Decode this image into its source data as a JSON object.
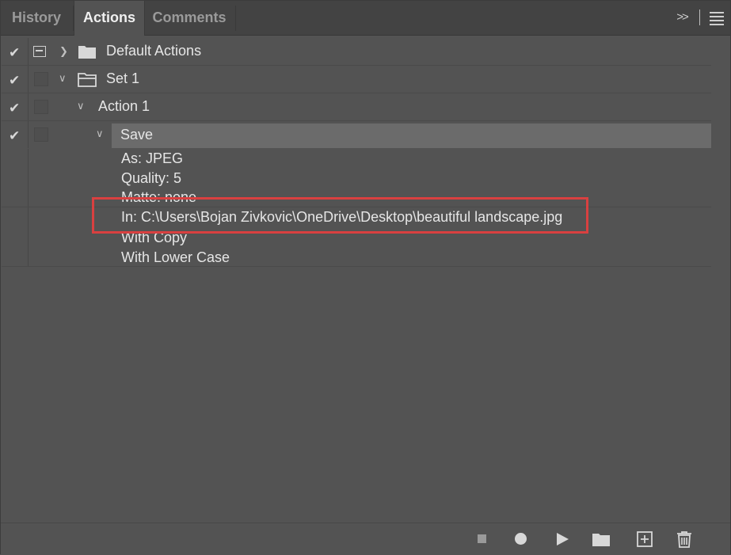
{
  "tabs": [
    {
      "label": "History",
      "active": false
    },
    {
      "label": "Actions",
      "active": true
    },
    {
      "label": "Comments",
      "active": false
    }
  ],
  "header": {
    "collapse_icon": "double-chevron-right-icon",
    "menu_icon": "panel-menu-icon"
  },
  "rows": {
    "default_actions": {
      "label": "Default Actions",
      "checked": true,
      "expanded": false
    },
    "set1": {
      "label": "Set 1",
      "checked": true,
      "expanded": true
    },
    "action1": {
      "label": "Action 1",
      "checked": true,
      "expanded": true
    },
    "save": {
      "label": "Save",
      "checked": true,
      "expanded": true,
      "selected": true
    }
  },
  "save_params": [
    "As: JPEG",
    "Quality: 5",
    "Matte: none",
    "In: C:\\Users\\Bojan Zivkovic\\OneDrive\\Desktop\\beautiful landscape.jpg",
    "With Copy",
    "With Lower Case"
  ],
  "colors": {
    "panel_bg": "#535353",
    "selected_row": "#6b6b6b",
    "highlight_outline": "#d94040"
  },
  "toolbar": {
    "buttons": [
      "stop-icon",
      "record-icon",
      "play-icon",
      "new-set-icon",
      "new-action-icon",
      "trash-icon"
    ]
  }
}
